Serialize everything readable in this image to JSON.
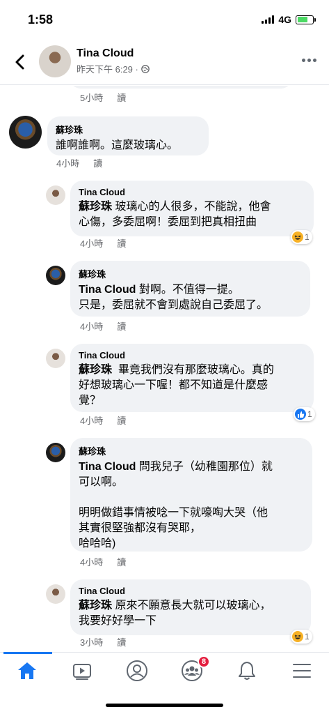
{
  "status_bar": {
    "time": "1:58",
    "network": "4G"
  },
  "header": {
    "name": "Tina Cloud",
    "subtitle": "昨天下午 6:29 ·"
  },
  "comments": [
    {
      "id": "c0",
      "meta_time": "5小時",
      "meta_action": "讀"
    },
    {
      "id": "c1",
      "author": "蘇珍珠",
      "text": "誰啊誰啊。這麼玻璃心。",
      "meta_time": "4小時",
      "meta_action": "讀"
    },
    {
      "id": "c2",
      "author": "Tina Cloud",
      "mention": "蘇珍珠",
      "text": " 玻璃心的人很多，不能說，他會\n心傷，多委屈啊！委屈到把真相扭曲",
      "meta_time": "4小時",
      "meta_action": "讀",
      "reaction": {
        "type": "haha",
        "count": "1"
      }
    },
    {
      "id": "c3",
      "author": "蘇珍珠",
      "mention": "Tina Cloud",
      "text": " 對啊。不值得一提。\n只是，委屈就不會到處說自己委屈了。",
      "meta_time": "4小時",
      "meta_action": "讀"
    },
    {
      "id": "c4",
      "author": "Tina Cloud",
      "mention": "蘇珍珠",
      "text": "  畢竟我們沒有那麼玻璃心。真的\n好想玻璃心一下喔！都不知道是什麼感\n覺？",
      "meta_time": "4小時",
      "meta_action": "讀",
      "reaction": {
        "type": "like",
        "count": "1"
      }
    },
    {
      "id": "c5",
      "author": "蘇珍珠",
      "mention": "Tina Cloud",
      "text": " 問我兒子（幼稚園那位）就\n可以啊。\n\n明明做錯事情被唸一下就嚎啕大哭（他\n其實很堅強都沒有哭耶，\n哈哈哈)",
      "meta_time": "4小時",
      "meta_action": "讀"
    },
    {
      "id": "c6",
      "author": "Tina Cloud",
      "mention": "蘇珍珠",
      "text": " 原來不願意長大就可以玻璃心，\n我要好好學一下",
      "meta_time": "3小時",
      "meta_action": "讀",
      "reaction": {
        "type": "haha",
        "count": "1"
      }
    }
  ],
  "tabbar": {
    "tabs": [
      {
        "name": "home",
        "icon": "home-icon",
        "active": true
      },
      {
        "name": "watch",
        "icon": "video-icon"
      },
      {
        "name": "profile",
        "icon": "profile-icon"
      },
      {
        "name": "groups",
        "icon": "groups-icon",
        "badge": "8"
      },
      {
        "name": "notifications",
        "icon": "bell-icon"
      },
      {
        "name": "menu",
        "icon": "menu-icon"
      }
    ]
  },
  "colors": {
    "accent": "#1877f2",
    "bubble": "#f0f2f5",
    "meta": "#65676b",
    "badge": "#e41e3f"
  }
}
